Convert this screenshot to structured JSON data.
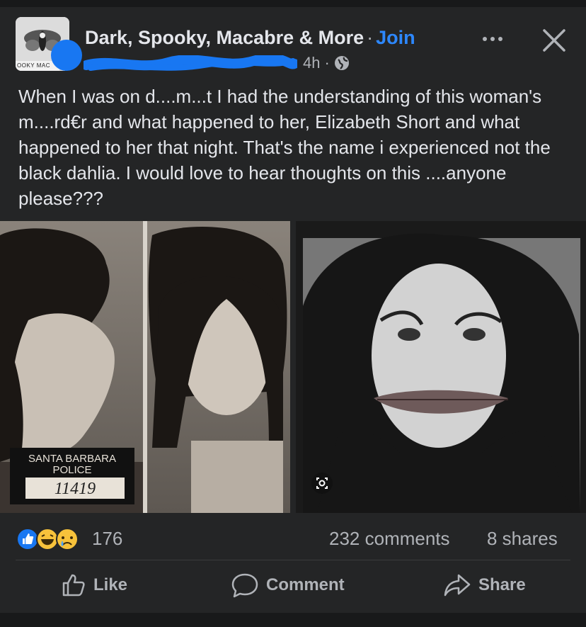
{
  "post": {
    "group_name": "Dark, Spooky, Macabre & More",
    "separator": "·",
    "join_label": "Join",
    "time": "4h",
    "meta_separator": "·",
    "avatar_text": "OOKY MAC",
    "text": "When I was on d....m...t I had the understanding of this woman's m....rd€r and what happened to her, Elizabeth Short and what happened to her that night. That's the name i experienced not the black dahlia. I would love to hear thoughts on this ....anyone please???"
  },
  "photo_left": {
    "sign_line1": "SANTA BARBARA",
    "sign_line2": "POLICE",
    "sign_number": "11419"
  },
  "stats": {
    "reaction_count": "176",
    "comments": "232 comments",
    "shares": "8 shares"
  },
  "actions": {
    "like": "Like",
    "comment": "Comment",
    "share": "Share"
  },
  "colors": {
    "background": "#18191a",
    "card": "#242526",
    "accent": "#2d88ff",
    "secondary_text": "#b0b3b8"
  },
  "icons": [
    "globe-icon",
    "more-icon",
    "close-icon",
    "like-reaction-icon",
    "haha-reaction-icon",
    "sad-reaction-icon",
    "visual-search-icon",
    "like-icon",
    "comment-icon",
    "share-icon"
  ]
}
